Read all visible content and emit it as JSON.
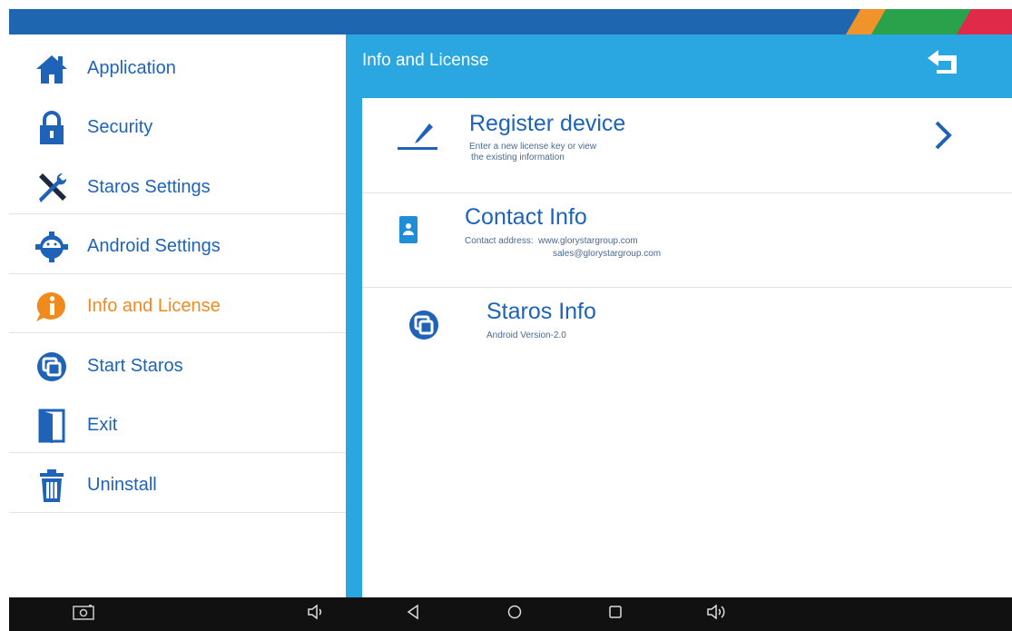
{
  "colors": {
    "header_blue": "#1e66b0",
    "panel_blue": "#2aa6e0",
    "menu_text": "#1e63b8",
    "active_text": "#f08a1c",
    "nav_black": "#111111"
  },
  "sidebar": {
    "items": [
      {
        "label": "Application",
        "icon": "home-icon",
        "active": false
      },
      {
        "label": "Security",
        "icon": "lock-icon",
        "active": false
      },
      {
        "label": "Staros Settings",
        "icon": "tools-icon",
        "active": false
      },
      {
        "label": "Android Settings",
        "icon": "android-icon",
        "active": false
      },
      {
        "label": "Info and License",
        "icon": "info-icon",
        "active": true
      },
      {
        "label": "Start Staros",
        "icon": "staros-icon",
        "active": false
      },
      {
        "label": "Exit",
        "icon": "exit-door-icon",
        "active": false
      },
      {
        "label": "Uninstall",
        "icon": "trash-icon",
        "active": false
      }
    ]
  },
  "panel": {
    "title": "Info and License",
    "back_icon": "back-arrow-icon",
    "rows": [
      {
        "title": "Register device",
        "subtitle_line1": "Enter a new license key or view",
        "subtitle_line2": "the existing information",
        "icon": "pencil-icon",
        "chevron_icon": "chevron-right-icon"
      },
      {
        "title": "Contact Info",
        "subtitle_line1": "Contact address:  www.glorystargroup.com",
        "subtitle_line2": "sales@glorystargroup.com",
        "icon": "contact-card-icon"
      },
      {
        "title": "Staros Info",
        "subtitle_line1": "Android Version-2.0",
        "icon": "staros-icon"
      }
    ]
  },
  "navbar": {
    "buttons": [
      "screenshot-icon",
      "volume-down-icon",
      "back-icon",
      "home-icon",
      "recents-icon",
      "volume-up-icon"
    ]
  }
}
